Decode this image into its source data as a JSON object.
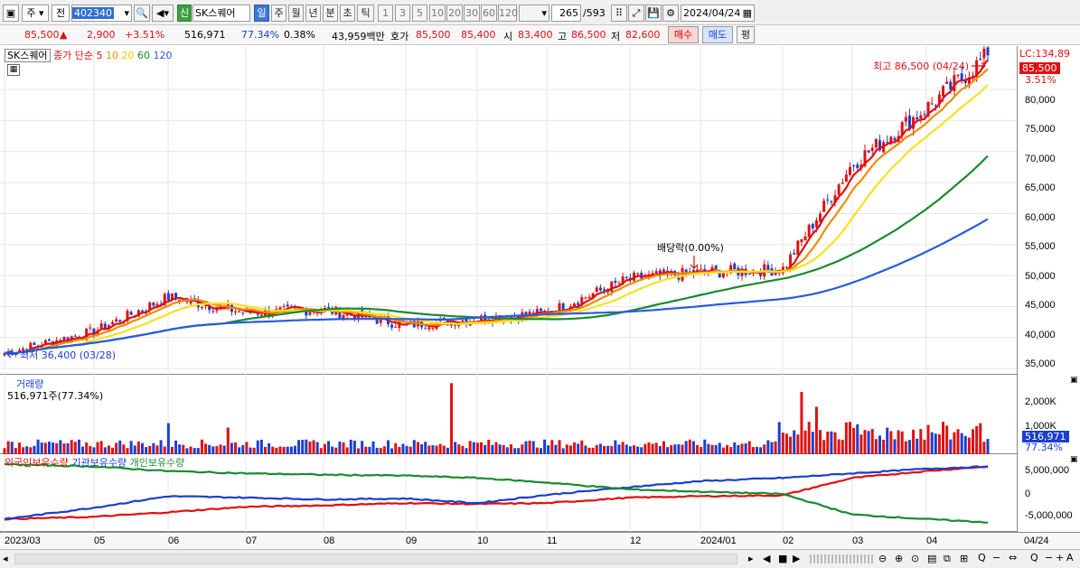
{
  "toolbar": {
    "market": "주",
    "mode": "전",
    "code": "402340",
    "badge": "신",
    "name": "SK스퀘어",
    "periods": [
      "일",
      "주",
      "월",
      "년",
      "분",
      "초",
      "틱"
    ],
    "nums": [
      "1",
      "3",
      "5",
      "10",
      "20",
      "30",
      "60",
      "120"
    ],
    "count": "265",
    "total": "/593",
    "date": "2024/04/24"
  },
  "quote": {
    "price": "85,500",
    "arrow": "▲",
    "change": "2,900",
    "pct": "+3.51%",
    "volume": "516,971",
    "vol_ratio": "77.34%",
    "turnover": "0.38%",
    "amount": "43,959백만",
    "ask_label": "호가",
    "ask": "85,500",
    "bid": "85,400",
    "open_label": "시",
    "open": "83,400",
    "high_label": "고",
    "high": "86,500",
    "low_label": "저",
    "low": "82,600",
    "buy": "매수",
    "sell": "매도",
    "flat": "평"
  },
  "price_pane": {
    "name": "SK스퀘어",
    "legend_label": "종가 단순",
    "ma": [
      "5",
      "10",
      "20",
      "60",
      "120"
    ],
    "max_note": "최고 86,500 (04/24)",
    "min_note": "최저 36,400 (03/28)",
    "dividend_note": "배당락(0.00%)",
    "lc": "LC:134,89",
    "cur": "85,500",
    "cur_pct": "3.51%",
    "ticks": [
      "80,000",
      "75,000",
      "70,000",
      "65,000",
      "60,000",
      "55,000",
      "50,000",
      "45,000",
      "40,000",
      "35,000"
    ]
  },
  "volume_pane": {
    "title": "거래량",
    "value": "516,971주(77.34%)",
    "ticks": [
      "2,000K",
      "1,000K"
    ],
    "cur": "516,971",
    "cur_pct": "77.34%"
  },
  "holding_pane": {
    "legend": [
      "외국인보유수량",
      "기관보유수량",
      "개인보유수량"
    ],
    "ticks": [
      "5,000,000",
      "0",
      "-5,000,000"
    ]
  },
  "x_axis": {
    "labels": [
      "2023/03",
      "05",
      "06",
      "07",
      "08",
      "09",
      "10",
      "11",
      "12",
      "2024/01",
      "02",
      "03",
      "04"
    ],
    "right": "04/24"
  },
  "colors": {
    "up": "#e01010",
    "down": "#1a3fd0",
    "ma5": "#e01010",
    "ma10": "#f08c00",
    "ma20": "#f8e020",
    "ma60": "#1a8a30",
    "ma120": "#2a5ae0"
  },
  "chart_data": {
    "type": "candlestick",
    "anchors_x": [
      "2023/03",
      "05",
      "06",
      "07",
      "08",
      "09",
      "10",
      "11",
      "12",
      "2024/01",
      "02",
      "03",
      "04",
      "04/24"
    ],
    "close_anchors": [
      37500,
      41000,
      46500,
      44000,
      44500,
      42000,
      43000,
      44000,
      49500,
      50500,
      51000,
      68000,
      77000,
      85500
    ],
    "ylim": [
      34000,
      87000
    ],
    "volume_max_k": 2500,
    "foreign_anchors": [
      -5500000,
      -5000000,
      -4000000,
      -2800000,
      -2500000,
      -2000000,
      -2200000,
      -2000000,
      -800000,
      -500000,
      -300000,
      3500000,
      5000000,
      6000000
    ],
    "inst_anchors": [
      -5500000,
      -3000000,
      -500000,
      -800000,
      -1200000,
      -1000000,
      -2000000,
      -200000,
      1500000,
      2800000,
      3500000,
      4500000,
      5500000,
      6000000
    ],
    "indiv_anchors": [
      6500000,
      6000000,
      5000000,
      4500000,
      4200000,
      4000000,
      3500000,
      2500000,
      1000000,
      500000,
      0,
      -4500000,
      -5500000,
      -6200000
    ]
  }
}
